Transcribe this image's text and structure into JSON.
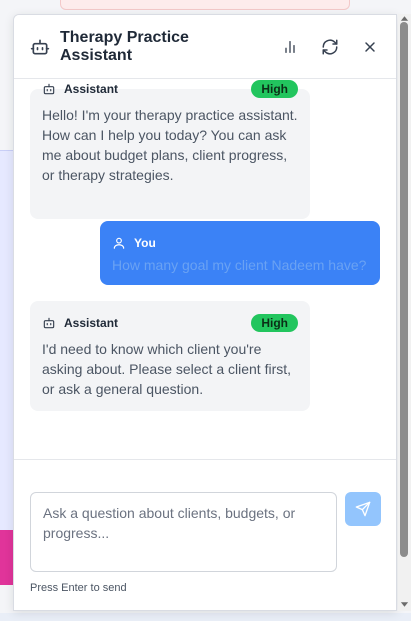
{
  "header": {
    "title": "Therapy Practice Assistant",
    "icons": [
      "bot-icon",
      "bar-chart-icon",
      "refresh-icon",
      "close-icon"
    ]
  },
  "messages": [
    {
      "sender": "Assistant",
      "badge": "High",
      "text": "Hello! I'm your therapy practice assistant. How can I help you today? You can ask me about budget plans, client progress, or therapy strategies."
    },
    {
      "sender": "You",
      "text": "How many goal my client Nadeem have?"
    },
    {
      "sender": "Assistant",
      "badge": "High",
      "text": "I'd need to know which client you're asking about. Please select a client first, or ask a general question."
    }
  ],
  "composer": {
    "placeholder": "Ask a question about clients, budgets, or progress...",
    "hint": "Press Enter to send"
  },
  "colors": {
    "user_bubble": "#3b82f6",
    "assistant_bubble": "#f3f4f6",
    "badge": "#22c55e",
    "send_button": "#93c5fd"
  }
}
